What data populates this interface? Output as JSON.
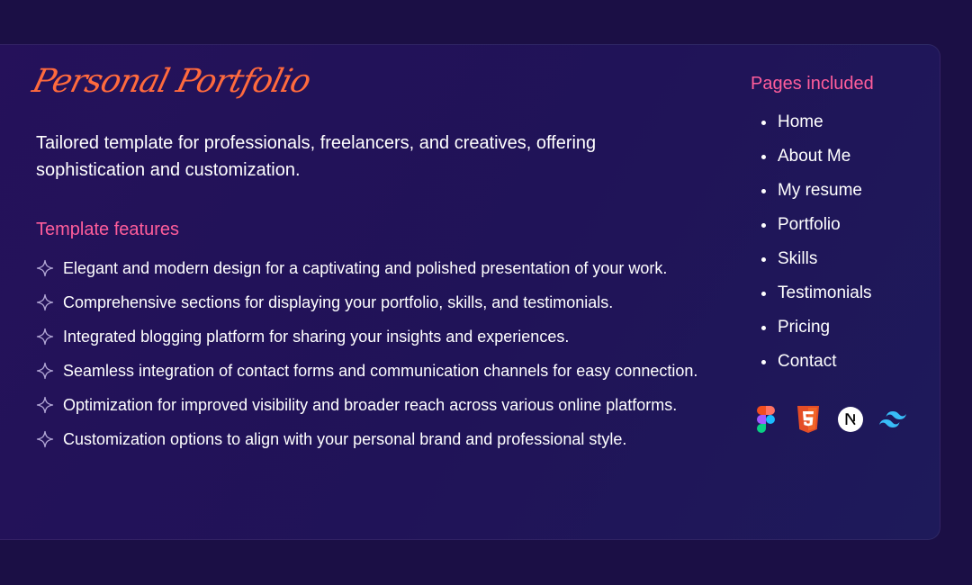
{
  "title": "Personal Portfolio",
  "description": "Tailored template for professionals, freelancers, and creatives, offering sophistication and customization.",
  "features": {
    "heading": "Template features",
    "items": [
      "Elegant and modern design for a captivating and polished presentation of your work.",
      "Comprehensive sections for displaying your portfolio, skills, and testimonials.",
      "Integrated blogging platform for sharing your insights and experiences.",
      "Seamless integration of contact forms and communication channels for easy connection.",
      "Optimization for improved visibility and broader reach across various online platforms.",
      "Customization options to align with your personal brand and professional style."
    ]
  },
  "pages": {
    "heading": "Pages included",
    "items": [
      "Home",
      "About Me",
      "My resume",
      "Portfolio",
      "Skills",
      "Testimonials",
      "Pricing",
      "Contact"
    ]
  },
  "tech_icons": [
    "figma-icon",
    "html5-icon",
    "nextjs-icon",
    "tailwind-icon"
  ],
  "colors": {
    "background": "#1b0f45",
    "title": "#ff6a3d",
    "heading": "#ff5d9b",
    "text": "#ffffff"
  }
}
